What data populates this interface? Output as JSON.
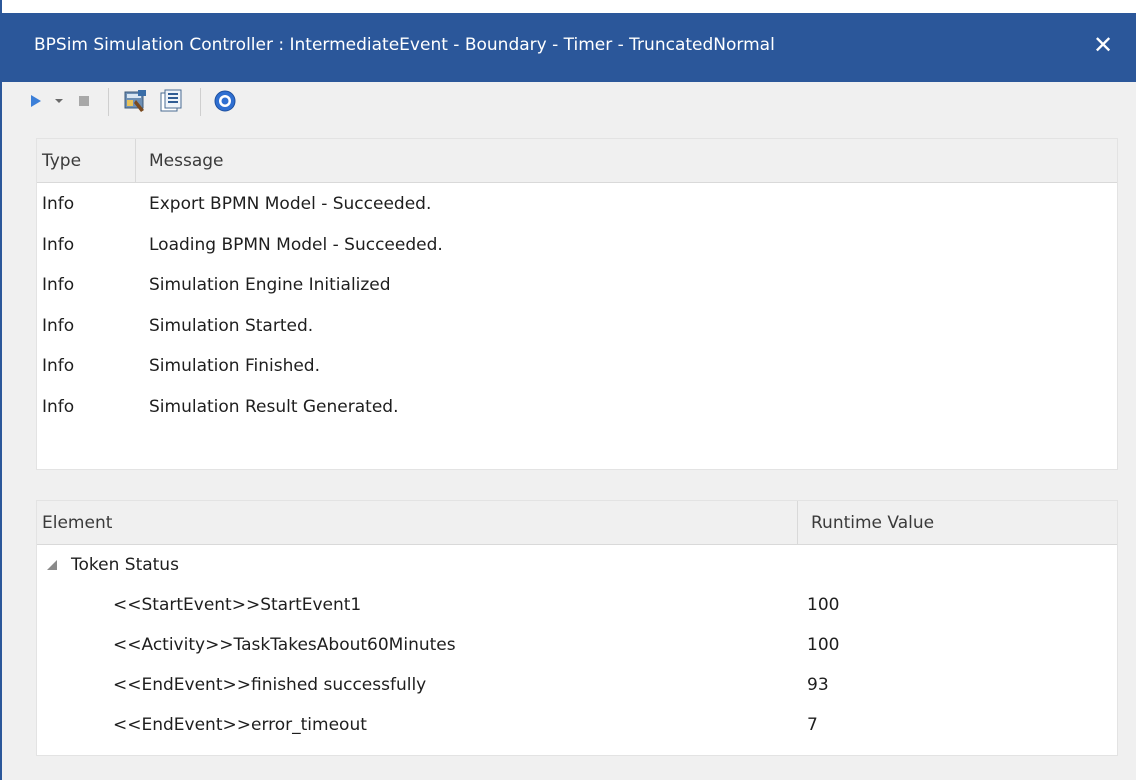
{
  "window": {
    "title": "BPSim Simulation Controller : IntermediateEvent - Boundary - Timer - TruncatedNormal",
    "close_glyph": "✕"
  },
  "toolbar": {
    "buttons": [
      {
        "name": "run-simulation",
        "icon": "play-icon"
      },
      {
        "name": "run-dropdown",
        "icon": "chevron-down-icon"
      },
      {
        "name": "stop-simulation",
        "icon": "stop-icon"
      },
      {
        "name": "configure",
        "icon": "configure-icon"
      },
      {
        "name": "results",
        "icon": "results-icon"
      },
      {
        "name": "help",
        "icon": "help-icon"
      }
    ]
  },
  "messages": {
    "columns": {
      "type": "Type",
      "message": "Message"
    },
    "rows": [
      {
        "type": "Info",
        "message": "Export BPMN Model - Succeeded."
      },
      {
        "type": "Info",
        "message": "Loading BPMN Model - Succeeded."
      },
      {
        "type": "Info",
        "message": "Simulation Engine Initialized"
      },
      {
        "type": "Info",
        "message": "Simulation Started."
      },
      {
        "type": "Info",
        "message": "Simulation Finished."
      },
      {
        "type": "Info",
        "message": "Simulation Result Generated."
      }
    ]
  },
  "results": {
    "columns": {
      "element": "Element",
      "runtime_value": "Runtime Value"
    },
    "group": {
      "label": "Token Status",
      "expanded": true
    },
    "rows": [
      {
        "element": "<<StartEvent>>StartEvent1",
        "value": "100"
      },
      {
        "element": "<<Activity>>TaskTakesAbout60Minutes",
        "value": "100"
      },
      {
        "element": "<<EndEvent>>finished successfully",
        "value": "93"
      },
      {
        "element": "<<EndEvent>>error_timeout",
        "value": "7"
      }
    ]
  },
  "colors": {
    "titlebar": "#2b579a",
    "play": "#3c7fd8",
    "help": "#2f6fd1"
  }
}
